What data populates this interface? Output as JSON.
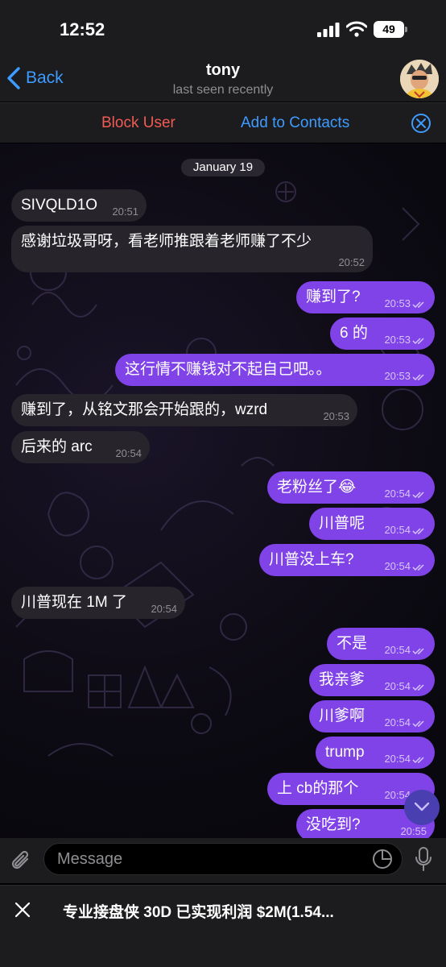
{
  "status_bar": {
    "time": "12:52",
    "battery": "49"
  },
  "header": {
    "back_label": "Back",
    "contact_name": "tony",
    "last_seen": "last seen recently"
  },
  "action_bar": {
    "block_label": "Block User",
    "add_label": "Add to Contacts"
  },
  "chat": {
    "date_label": "January 19",
    "messages": [
      {
        "dir": "in",
        "text": "SIVQLD1O",
        "time": "20:51"
      },
      {
        "dir": "in",
        "text": "感谢垃圾哥呀，看老师推跟着老师赚了不少",
        "time": "20:52"
      },
      {
        "dir": "out",
        "text": "赚到了?",
        "time": "20:53"
      },
      {
        "dir": "out",
        "text": "6 的",
        "time": "20:53"
      },
      {
        "dir": "out",
        "text": "这行情不赚钱对不起自己吧。。",
        "time": "20:53"
      },
      {
        "dir": "in",
        "text": "赚到了，从铭文那会开始跟的，wzrd",
        "time": "20:53"
      },
      {
        "dir": "in",
        "text": "后来的 arc",
        "time": "20:54"
      },
      {
        "dir": "out",
        "text": "老粉丝了😂",
        "time": "20:54"
      },
      {
        "dir": "out",
        "text": "川普呢",
        "time": "20:54"
      },
      {
        "dir": "out",
        "text": "川普没上车?",
        "time": "20:54"
      },
      {
        "dir": "in",
        "text": "川普现在 1M 了",
        "time": "20:54"
      },
      {
        "dir": "out",
        "text": "不是",
        "time": "20:54"
      },
      {
        "dir": "out",
        "text": "我亲爹",
        "time": "20:54"
      },
      {
        "dir": "out",
        "text": "川爹啊",
        "time": "20:54"
      },
      {
        "dir": "out",
        "text": "trump",
        "time": "20:54"
      },
      {
        "dir": "out",
        "text": "上 cb的那个",
        "time": "20:54"
      },
      {
        "dir": "out",
        "text": "没吃到?",
        "time": "20:55"
      }
    ]
  },
  "input": {
    "placeholder": "Message"
  },
  "banner": {
    "text": "专业接盘侠 30D 已实现利润 $2M(1.54..."
  },
  "colors": {
    "accent": "#3e9bff",
    "danger": "#ef5b54",
    "outgoing": "#8043e8",
    "incoming": "#27252b"
  },
  "icons": [
    "back-chevron-icon",
    "signal-icon",
    "wifi-icon",
    "battery-icon",
    "close-circle-icon",
    "attach-icon",
    "sticker-icon",
    "mic-icon",
    "scroll-down-icon",
    "close-icon",
    "read-ticks-icon"
  ]
}
